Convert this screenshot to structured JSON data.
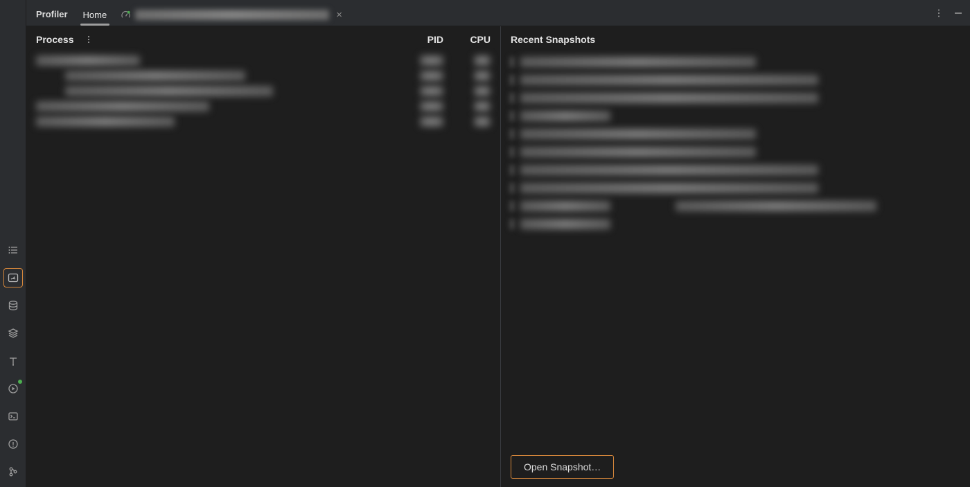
{
  "title": "Profiler",
  "tabs": {
    "home": {
      "label": "Home",
      "active": true
    },
    "profiletab": {
      "label": "(redacted)",
      "active": false
    }
  },
  "left_pane": {
    "header": "Process",
    "col_pid": "PID",
    "col_cpu": "CPU",
    "rows": 5
  },
  "right_pane": {
    "header": "Recent Snapshots",
    "rows": 10,
    "open_button": "Open Snapshot…"
  },
  "accent": "#d6873b"
}
